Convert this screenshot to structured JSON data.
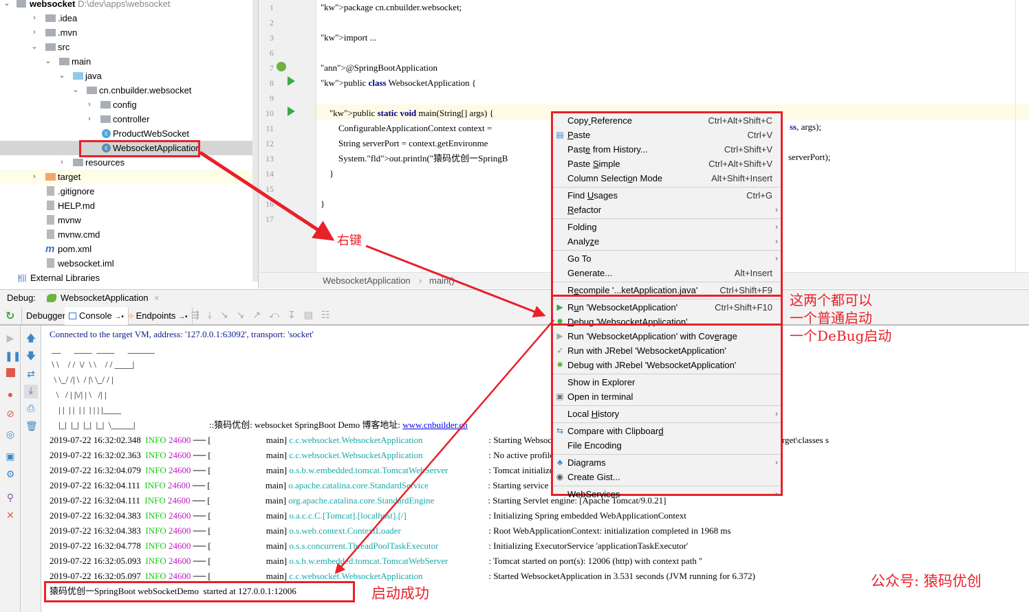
{
  "project_tree": {
    "root": {
      "name": "websocket",
      "path": "D:\\dev\\apps\\websocket"
    },
    "items": [
      {
        "label": ".idea",
        "type": "folder",
        "depth": 1,
        "expanded": false
      },
      {
        "label": ".mvn",
        "type": "folder",
        "depth": 1,
        "expanded": false
      },
      {
        "label": "src",
        "type": "folder",
        "depth": 1,
        "expanded": true
      },
      {
        "label": "main",
        "type": "folder",
        "depth": 2,
        "expanded": true
      },
      {
        "label": "java",
        "type": "source-folder",
        "depth": 3,
        "expanded": true
      },
      {
        "label": "cn.cnbuilder.websocket",
        "type": "package",
        "depth": 4,
        "expanded": true
      },
      {
        "label": "config",
        "type": "package",
        "depth": 5,
        "expanded": false
      },
      {
        "label": "controller",
        "type": "package",
        "depth": 5,
        "expanded": false
      },
      {
        "label": "ProductWebSocket",
        "type": "class",
        "depth": 5
      },
      {
        "label": "WebsocketApplication",
        "type": "spring-class",
        "depth": 5,
        "selected": true
      },
      {
        "label": "resources",
        "type": "resources-folder",
        "depth": 3,
        "expanded": false
      },
      {
        "label": "target",
        "type": "excluded-folder",
        "depth": 1,
        "expanded": false
      },
      {
        "label": ".gitignore",
        "type": "file",
        "depth": 1
      },
      {
        "label": "HELP.md",
        "type": "markdown",
        "depth": 1
      },
      {
        "label": "mvnw",
        "type": "file",
        "depth": 1
      },
      {
        "label": "mvnw.cmd",
        "type": "file",
        "depth": 1
      },
      {
        "label": "pom.xml",
        "type": "maven",
        "depth": 1
      },
      {
        "label": "websocket.iml",
        "type": "iml",
        "depth": 1
      },
      {
        "label": "External Libraries",
        "type": "libraries",
        "depth": 0,
        "expanded": false
      }
    ]
  },
  "editor": {
    "lines": [
      {
        "n": "1",
        "code": "package cn.cnbuilder.websocket;"
      },
      {
        "n": "2",
        "code": ""
      },
      {
        "n": "3",
        "code": "import ..."
      },
      {
        "n": "6",
        "code": ""
      },
      {
        "n": "7",
        "code": "@SpringBootApplication"
      },
      {
        "n": "8",
        "code": "public class WebsocketApplication {"
      },
      {
        "n": "9",
        "code": ""
      },
      {
        "n": "10",
        "code": "    public static void main(String[] args) {"
      },
      {
        "n": "11",
        "code": "        ConfigurableApplicationContext context = "
      },
      {
        "n": "12",
        "code": "        String serverPort = context.getEnvironme"
      },
      {
        "n": "13",
        "code": "        System.out.println(\"猿码优创一SpringB"
      },
      {
        "n": "14",
        "code": "    }"
      },
      {
        "n": "15",
        "code": ""
      },
      {
        "n": "16",
        "code": "}"
      },
      {
        "n": "17",
        "code": ""
      }
    ],
    "overflow_line11": "ss, args);",
    "overflow_line13": "serverPort);",
    "breadcrumb": [
      "WebsocketApplication",
      "main()"
    ]
  },
  "context_menu": {
    "items": [
      {
        "label": "Copy Reference",
        "shortcut": "Ctrl+Alt+Shift+C"
      },
      {
        "label": "Paste",
        "shortcut": "Ctrl+V",
        "icon": "paste-icon"
      },
      {
        "label": "Paste from History...",
        "shortcut": "Ctrl+Shift+V"
      },
      {
        "label": "Paste Simple",
        "shortcut": "Ctrl+Alt+Shift+V"
      },
      {
        "label": "Column Selection Mode",
        "shortcut": "Alt+Shift+Insert"
      },
      {
        "label": "Find Usages",
        "shortcut": "Ctrl+G"
      },
      {
        "label": "Refactor",
        "submenu": true
      },
      {
        "label": "Folding",
        "submenu": true
      },
      {
        "label": "Analyze",
        "submenu": true
      },
      {
        "label": "Go To",
        "submenu": true
      },
      {
        "label": "Generate...",
        "shortcut": "Alt+Insert"
      },
      {
        "label": "Recompile '...ketApplication.java'",
        "shortcut": "Ctrl+Shift+F9"
      },
      {
        "label": "Run 'WebsocketApplication'",
        "shortcut": "Ctrl+Shift+F10",
        "icon": "run-icon"
      },
      {
        "label": "Debug 'WebsocketApplication'",
        "icon": "debug-icon"
      },
      {
        "label": "Run 'WebsocketApplication' with Coverage",
        "icon": "coverage-icon"
      },
      {
        "label": "Run with JRebel 'WebsocketApplication'",
        "icon": "jrebel-run-icon"
      },
      {
        "label": "Debug with JRebel 'WebsocketApplication'",
        "icon": "jrebel-debug-icon"
      },
      {
        "label": "Show in Explorer"
      },
      {
        "label": "Open in terminal",
        "icon": "terminal-icon"
      },
      {
        "label": "Local History",
        "submenu": true
      },
      {
        "label": "Compare with Clipboard",
        "icon": "compare-icon"
      },
      {
        "label": "File Encoding"
      },
      {
        "label": "Diagrams",
        "submenu": true,
        "icon": "diagram-icon"
      },
      {
        "label": "Create Gist...",
        "icon": "github-icon"
      },
      {
        "label": "WebServices",
        "submenu": true
      }
    ]
  },
  "debug_panel": {
    "label": "Debug:",
    "run_config": "WebsocketApplication",
    "tabs": [
      "Debugger",
      "Console",
      "Endpoints"
    ],
    "active_tab": "Console"
  },
  "console": {
    "connected": "Connected to the target VM, address: '127.0.0.1:63092', transport: 'socket'",
    "banner": [
      " __      ____  ____      ______",
      " \\ \\    / /  \\/  \\ \\    / / ____|",
      "  \\ \\_/ /| \\  / |\\ \\_/ / |",
      "   \\   / | |\\/| | \\   /| |",
      "    | |  | |  | |  | | | |____",
      "    |_|  |_|  |_|  |_|  \\_____|"
    ],
    "banner_suffix": "::猿码优创: websocket SpringBoot Demo 博客地址: ",
    "banner_link": "www.cnbuilder.cn",
    "log": [
      {
        "ts": "2019-07-22 16:32:02.348",
        "level": "INFO",
        "pid": "24600",
        "thread": "main",
        "logger": "c.c.websocket.WebsocketApplication",
        "msg": ": Starting WebsocketApplication on ... with PID 24600 (D:\\dev\\apps\\websocket\\target\\classes s"
      },
      {
        "ts": "2019-07-22 16:32:02.363",
        "level": "INFO",
        "pid": "24600",
        "thread": "main",
        "logger": "c.c.websocket.WebsocketApplication",
        "msg": ": No active profile set, falling back to default profiles: default"
      },
      {
        "ts": "2019-07-22 16:32:04.079",
        "level": "INFO",
        "pid": "24600",
        "thread": "main",
        "logger": "o.s.b.w.embedded.tomcat.TomcatWebServer",
        "msg": ": Tomcat initialized with port(s): 12006 (http)"
      },
      {
        "ts": "2019-07-22 16:32:04.111",
        "level": "INFO",
        "pid": "24600",
        "thread": "main",
        "logger": "o.apache.catalina.core.StandardService",
        "msg": ": Starting service [Tomcat]"
      },
      {
        "ts": "2019-07-22 16:32:04.111",
        "level": "INFO",
        "pid": "24600",
        "thread": "main",
        "logger": "org.apache.catalina.core.StandardEngine",
        "msg": ": Starting Servlet engine: [Apache Tomcat/9.0.21]"
      },
      {
        "ts": "2019-07-22 16:32:04.383",
        "level": "INFO",
        "pid": "24600",
        "thread": "main",
        "logger": "o.a.c.c.C.[Tomcat].[localhost].[/]",
        "msg": ": Initializing Spring embedded WebApplicationContext"
      },
      {
        "ts": "2019-07-22 16:32:04.383",
        "level": "INFO",
        "pid": "24600",
        "thread": "main",
        "logger": "o.s.web.context.ContextLoader",
        "msg": ": Root WebApplicationContext: initialization completed in 1968 ms"
      },
      {
        "ts": "2019-07-22 16:32:04.778",
        "level": "INFO",
        "pid": "24600",
        "thread": "main",
        "logger": "o.s.s.concurrent.ThreadPoolTaskExecutor",
        "msg": ": Initializing ExecutorService 'applicationTaskExecutor'"
      },
      {
        "ts": "2019-07-22 16:32:05.093",
        "level": "INFO",
        "pid": "24600",
        "thread": "main",
        "logger": "o.s.b.w.embedded.tomcat.TomcatWebServer",
        "msg": ": Tomcat started on port(s): 12006 (http) with context path ''"
      },
      {
        "ts": "2019-07-22 16:32:05.097",
        "level": "INFO",
        "pid": "24600",
        "thread": "main",
        "logger": "c.c.websocket.WebsocketApplication",
        "msg": ": Started WebsocketApplication in 3.531 seconds (JVM running for 6.372)"
      }
    ],
    "final_line": "猿码优创一SpringBoot webSocketDemo  started at 127.0.0.1:12006"
  },
  "annotations": {
    "right_click": "右键",
    "both_ok": "这两个都可以\n一个普通启动\n一个DeBug启动",
    "started_ok": "启动成功",
    "wechat": "公众号: 猿码优创"
  },
  "colors": {
    "annotation_red": "#e8202a",
    "run_green": "#3aaa48",
    "log_info": "#11cc11",
    "log_pid": "#c019c0",
    "log_logger": "#17a8a8"
  }
}
